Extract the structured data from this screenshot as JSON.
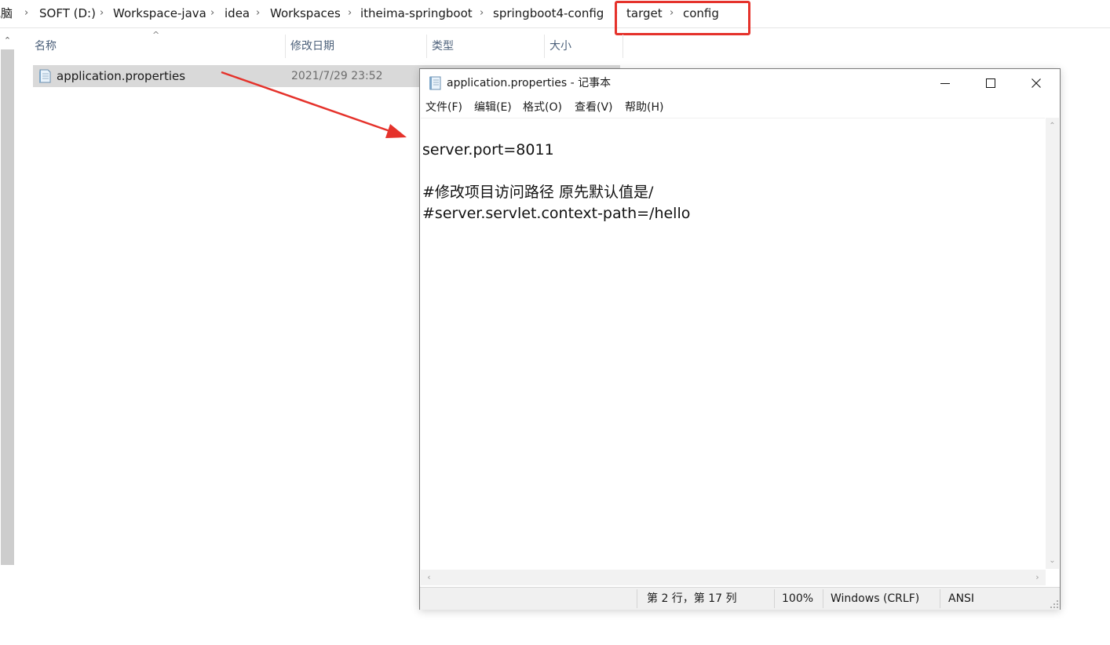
{
  "explorer": {
    "breadcrumb": [
      "电脑",
      "SOFT (D:)",
      "Workspace-java",
      "idea",
      "Workspaces",
      "itheima-springboot",
      "springboot4-config",
      "target",
      "config"
    ],
    "columns": {
      "name": "名称",
      "modified": "修改日期",
      "type": "类型",
      "size": "大小"
    },
    "files": [
      {
        "name": "application.properties",
        "modified": "2021/7/29 23:52"
      }
    ],
    "highlight_color": "#e5322b"
  },
  "notepad": {
    "title": "application.properties - 记事本",
    "menu": [
      "文件(F)",
      "编辑(E)",
      "格式(O)",
      "查看(V)",
      "帮助(H)"
    ],
    "content": "server.port=8011\n\n#修改项目访问路径 原先默认值是/\n#server.servlet.context-path=/hello",
    "status": {
      "position": "第 2 行，第 17 列",
      "zoom": "100%",
      "line_ending": "Windows (CRLF)",
      "encoding": "ANSI"
    }
  }
}
